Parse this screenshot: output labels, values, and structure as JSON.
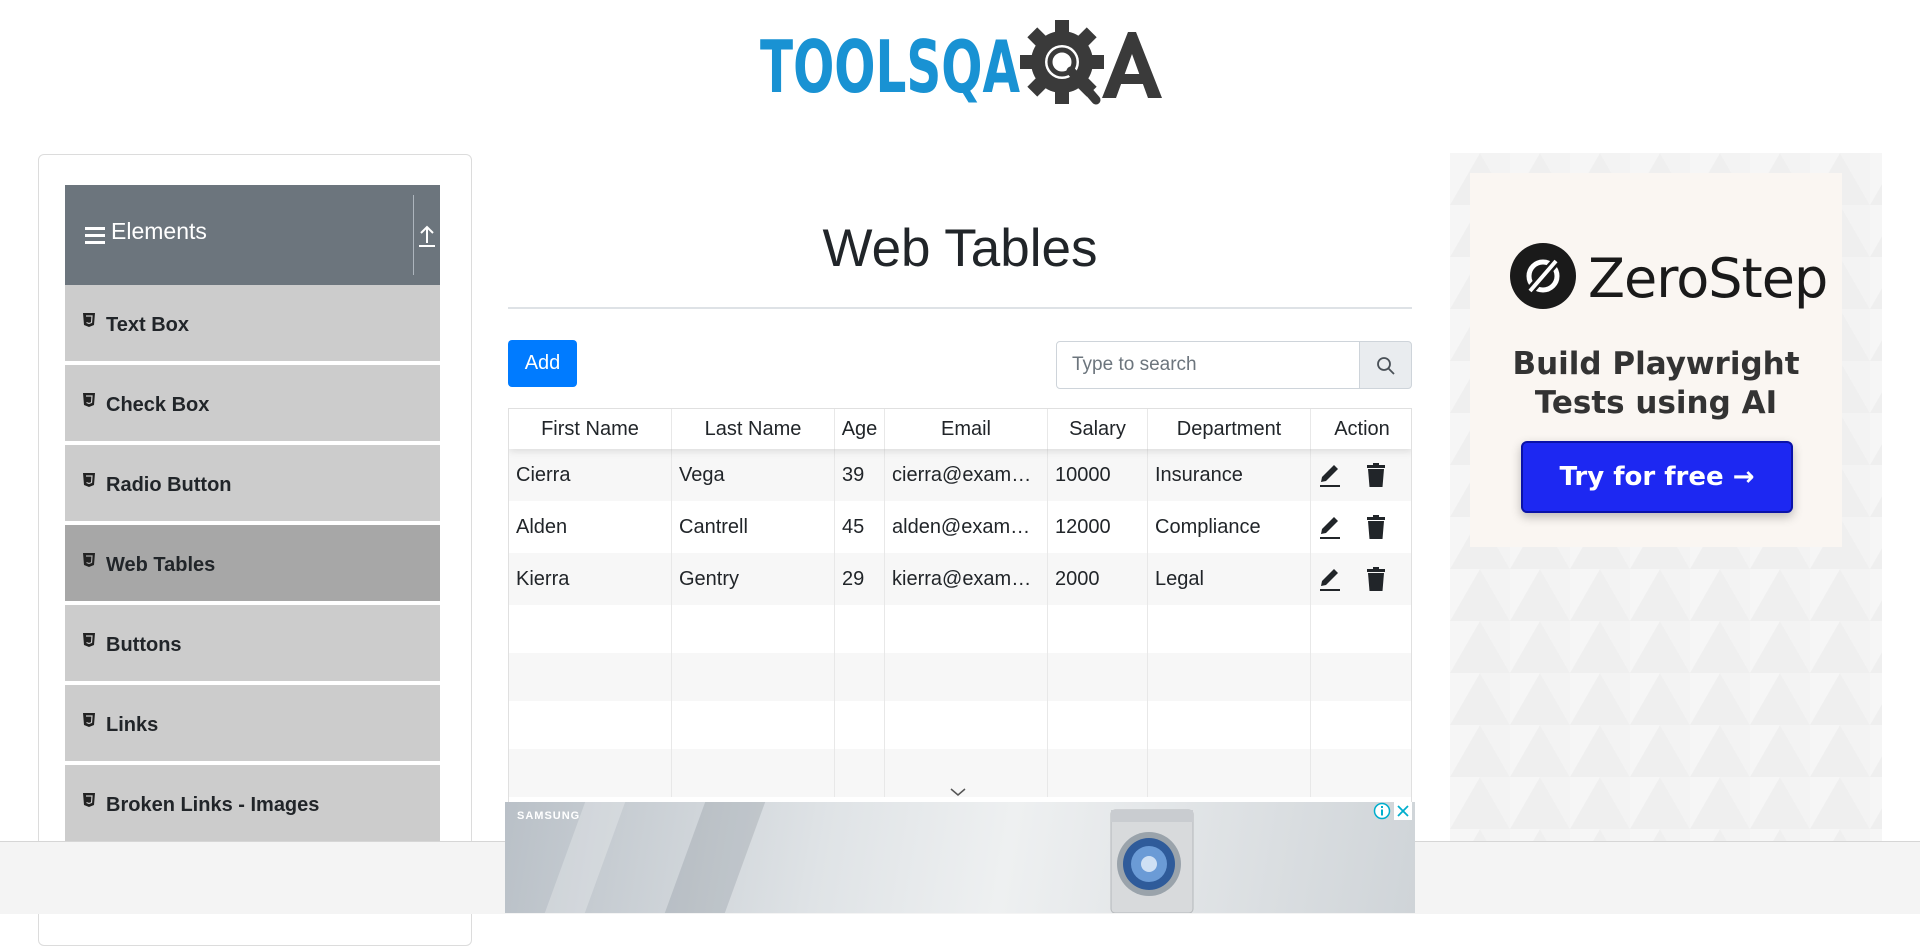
{
  "header": {
    "logo": "TOOLSQA"
  },
  "sidebar": {
    "group_title": "Elements",
    "items": [
      {
        "label": "Text Box",
        "active": false
      },
      {
        "label": "Check Box",
        "active": false
      },
      {
        "label": "Radio Button",
        "active": false
      },
      {
        "label": "Web Tables",
        "active": true
      },
      {
        "label": "Buttons",
        "active": false
      },
      {
        "label": "Links",
        "active": false
      },
      {
        "label": "Broken Links - Images",
        "active": false
      }
    ]
  },
  "main": {
    "title": "Web Tables",
    "add_label": "Add",
    "search": {
      "placeholder": "Type to search",
      "value": ""
    },
    "table": {
      "columns": [
        "First Name",
        "Last Name",
        "Age",
        "Email",
        "Salary",
        "Department",
        "Action"
      ],
      "rows": [
        [
          "Cierra",
          "Vega",
          "39",
          "cierra@example.com",
          "10000",
          "Insurance"
        ],
        [
          "Alden",
          "Cantrell",
          "45",
          "alden@example.com",
          "12000",
          "Compliance"
        ],
        [
          "Kierra",
          "Gentry",
          "29",
          "kierra@example.com",
          "2000",
          "Legal"
        ]
      ]
    }
  },
  "right_ad": {
    "brand": "ZeroStep",
    "tagline_line1": "Build Playwright",
    "tagline_line2": "Tests using AI",
    "cta": "Try for free →"
  },
  "bottom_ad": {
    "brand": "SAMSUNG"
  },
  "colors": {
    "accent": "#007bff",
    "sidebar_header": "#6c757d",
    "menu_item": "#cccccc",
    "menu_item_active": "#a7a7a7",
    "logo_blue": "#1992d3",
    "cta_blue": "#1d28f2"
  }
}
